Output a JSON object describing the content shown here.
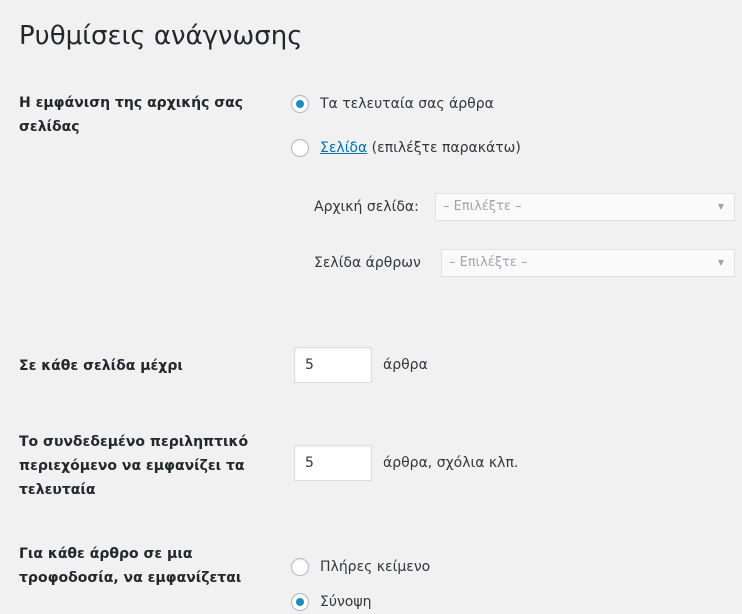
{
  "page_title": "Ρυθμίσεις ανάγνωσης",
  "front_page": {
    "label": "Η εμφάνιση της αρχικής σας σελίδας",
    "options": [
      {
        "text": "Τα τελευταία σας άρθρα",
        "checked": true
      },
      {
        "link_text": "Σελίδα",
        "text": " (επιλέξτε παρακάτω)",
        "checked": false
      }
    ],
    "homepage_select": {
      "label": "Αρχική σελίδα:",
      "value": "– Επιλέξτε –"
    },
    "posts_page_select": {
      "label": "Σελίδα άρθρων",
      "value": "– Επιλέξτε –"
    }
  },
  "posts_per_page": {
    "label": "Σε κάθε σελίδα μέχρι",
    "value": "5",
    "suffix": "άρθρα"
  },
  "feed_items": {
    "label": "Το συνδεδεμένο περιληπτικό περιεχόμενο να εμφανίζει τα τελευταία",
    "value": "5",
    "suffix": "άρθρα, σχόλια κλπ."
  },
  "feed_content": {
    "label": "Για κάθε άρθρο σε μια τροφοδοσία, να εμφανίζεται",
    "options": [
      {
        "text": "Πλήρες κείμενο",
        "checked": false
      },
      {
        "text": "Σύνοψη",
        "checked": true
      }
    ]
  },
  "colors": {
    "background": "#f1f1f1",
    "accent": "#0073aa",
    "radio_dot": "#1e8cbe"
  }
}
